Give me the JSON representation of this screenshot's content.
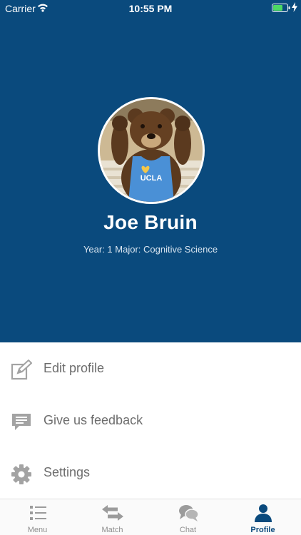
{
  "status_bar": {
    "carrier": "Carrier",
    "time": "10:55 PM",
    "battery_color": "#4cd964"
  },
  "profile": {
    "name": "Joe Bruin",
    "info": "Year: 1 Major: Cognitive Science",
    "header_color": "#0a4a7d",
    "shirt_text": "UCLA"
  },
  "menu": {
    "items": [
      {
        "label": "Edit profile",
        "icon": "edit-icon"
      },
      {
        "label": "Give us feedback",
        "icon": "feedback-icon"
      },
      {
        "label": "Settings",
        "icon": "gear-icon"
      }
    ]
  },
  "tab_bar": {
    "tabs": [
      {
        "label": "Menu",
        "icon": "list-icon"
      },
      {
        "label": "Match",
        "icon": "swap-arrows-icon"
      },
      {
        "label": "Chat",
        "icon": "chat-bubbles-icon"
      },
      {
        "label": "Profile",
        "icon": "person-icon",
        "active": true
      }
    ],
    "active_color": "#0a4a7d"
  }
}
